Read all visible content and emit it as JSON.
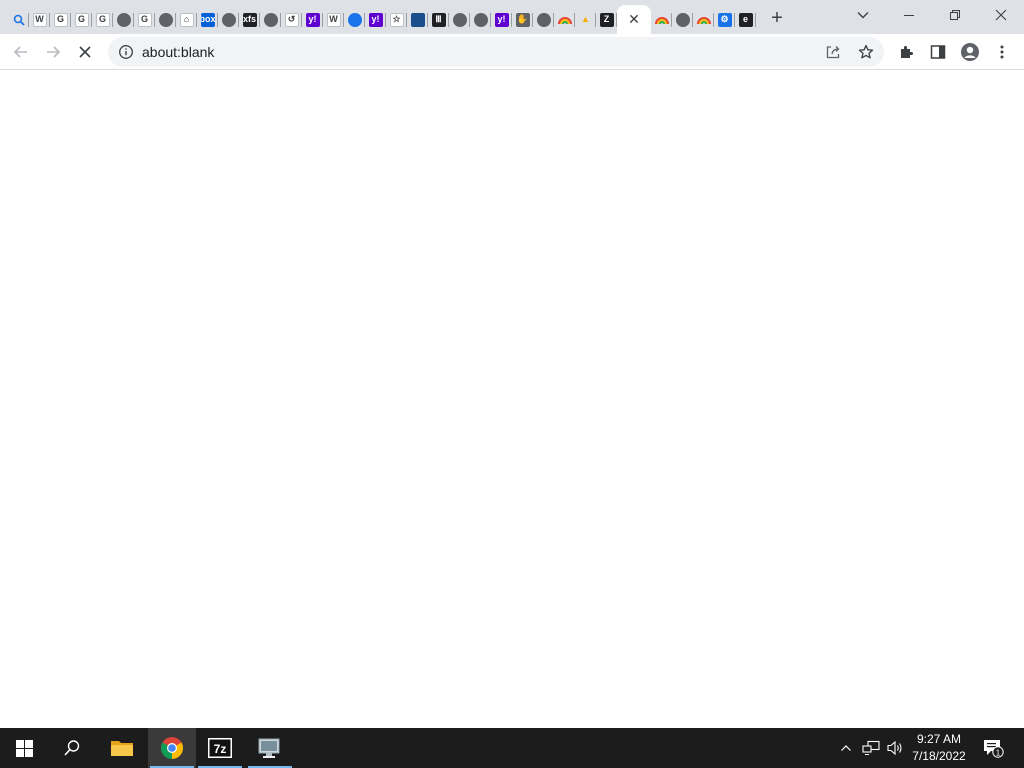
{
  "browser": {
    "tabs": [
      {
        "icon": "search-favicon",
        "glyph": "",
        "bg": "#ffffff"
      },
      {
        "icon": "wikipedia-favicon",
        "glyph": "W",
        "bg": "#ffffff"
      },
      {
        "icon": "google-favicon",
        "glyph": "G",
        "bg": "#ffffff"
      },
      {
        "icon": "google-favicon",
        "glyph": "G",
        "bg": "#ffffff"
      },
      {
        "icon": "google-favicon",
        "glyph": "G",
        "bg": "#ffffff"
      },
      {
        "icon": "globe-favicon",
        "glyph": "",
        "bg": "#5f6368"
      },
      {
        "icon": "google-favicon",
        "glyph": "G",
        "bg": "#ffffff"
      },
      {
        "icon": "globe-favicon",
        "glyph": "",
        "bg": "#5f6368"
      },
      {
        "icon": "home-favicon",
        "glyph": "⌂",
        "bg": "#ffffff"
      },
      {
        "icon": "box-favicon",
        "glyph": "box",
        "bg": "#0061d5"
      },
      {
        "icon": "globe-favicon",
        "glyph": "",
        "bg": "#5f6368"
      },
      {
        "icon": "xfs-favicon",
        "glyph": "xfs",
        "bg": "#202124"
      },
      {
        "icon": "globe-favicon",
        "glyph": "",
        "bg": "#5f6368"
      },
      {
        "icon": "history-favicon",
        "glyph": "↺",
        "bg": "#ffffff"
      },
      {
        "icon": "yahoo-favicon",
        "glyph": "y!",
        "bg": "#5f01d1"
      },
      {
        "icon": "wikipedia-favicon",
        "glyph": "W",
        "bg": "#ffffff"
      },
      {
        "icon": "globe-blue-favicon",
        "glyph": "",
        "bg": "#1a73e8"
      },
      {
        "icon": "yahoo-favicon",
        "glyph": "y!",
        "bg": "#5f01d1"
      },
      {
        "icon": "star-favicon",
        "glyph": "☆",
        "bg": "#ffffff"
      },
      {
        "icon": "window-favicon",
        "glyph": "",
        "bg": "#1a4f8b"
      },
      {
        "icon": "museum-favicon",
        "glyph": "Ⅲ",
        "bg": "#202124"
      },
      {
        "icon": "globe-favicon",
        "glyph": "",
        "bg": "#5f6368"
      },
      {
        "icon": "globe-favicon",
        "glyph": "",
        "bg": "#5f6368"
      },
      {
        "icon": "yahoo-favicon",
        "glyph": "y!",
        "bg": "#5f01d1"
      },
      {
        "icon": "hand-favicon",
        "glyph": "✋",
        "bg": "#5f6368"
      },
      {
        "icon": "globe-favicon",
        "glyph": "",
        "bg": "#5f6368"
      },
      {
        "icon": "rainbow-favicon",
        "glyph": "",
        "bg": "#ffffff"
      },
      {
        "icon": "warning-favicon",
        "glyph": "▲",
        "bg": "#ffffff"
      },
      {
        "icon": "slash-favicon",
        "glyph": "Z",
        "bg": "#202124"
      }
    ],
    "tabs_after": [
      {
        "icon": "rainbow-favicon",
        "glyph": "",
        "bg": "#ffffff"
      },
      {
        "icon": "globe-favicon",
        "glyph": "",
        "bg": "#5f6368"
      },
      {
        "icon": "rainbow-favicon",
        "glyph": "",
        "bg": "#ffffff"
      },
      {
        "icon": "settings-favicon",
        "glyph": "⚙",
        "bg": "#1a73e8"
      },
      {
        "icon": "e-favicon",
        "glyph": "e",
        "bg": "#202124"
      }
    ],
    "new_tab_glyph": "+",
    "close_tab_glyph": "✕",
    "address": "about:blank",
    "accent": "#1a73e8"
  },
  "taskbar": {
    "time": "9:27 AM",
    "date": "7/18/2022",
    "notification_count": "1",
    "apps": [
      "start",
      "search",
      "file-explorer",
      "chrome",
      "7-zip",
      "remote-desktop"
    ]
  }
}
